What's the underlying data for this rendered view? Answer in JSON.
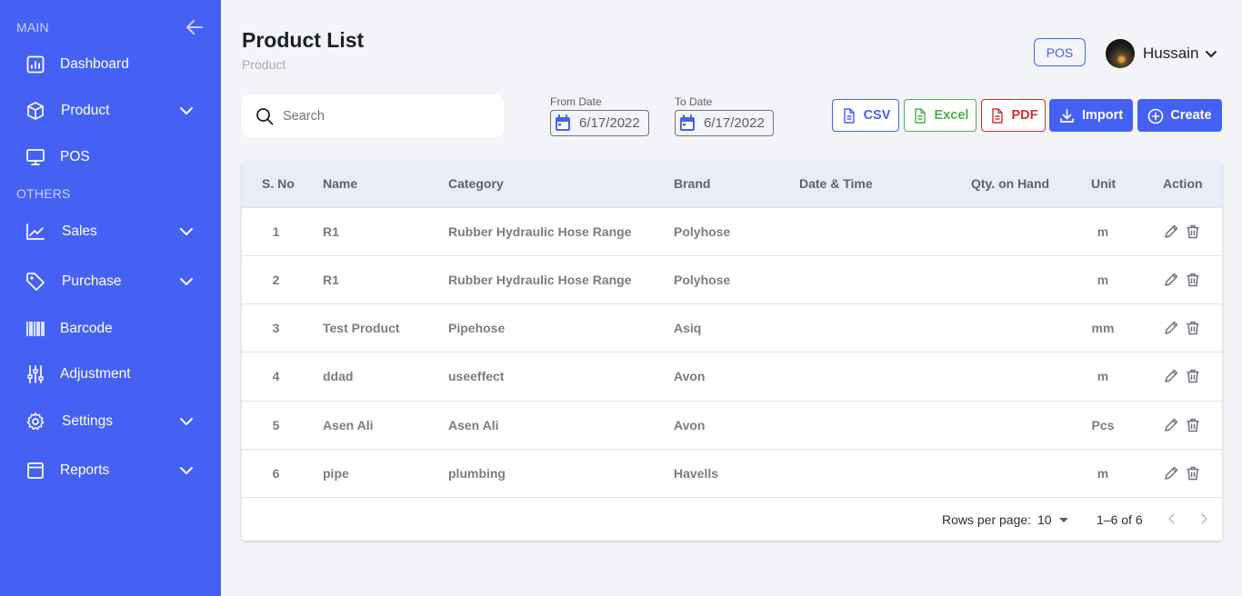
{
  "sidebar": {
    "section_main": "MAIN",
    "section_others": "OTHERS",
    "items": [
      {
        "label": "Dashboard",
        "icon": "dashboard-icon",
        "has_children": false
      },
      {
        "label": "Product",
        "icon": "box-icon",
        "has_children": true
      },
      {
        "label": "POS",
        "icon": "monitor-icon",
        "has_children": false
      },
      {
        "label": "Sales",
        "icon": "chart-line-icon",
        "has_children": true
      },
      {
        "label": "Purchase",
        "icon": "tag-icon",
        "has_children": true
      },
      {
        "label": "Barcode",
        "icon": "barcode-icon",
        "has_children": false
      },
      {
        "label": "Adjustment",
        "icon": "sliders-icon",
        "has_children": false
      },
      {
        "label": "Settings",
        "icon": "gear-icon",
        "has_children": true
      },
      {
        "label": "Reports",
        "icon": "window-icon",
        "has_children": true
      }
    ]
  },
  "header": {
    "title": "Product List",
    "breadcrumb": "Product",
    "pos_button": "POS",
    "user_name": "Hussain"
  },
  "toolbar": {
    "search_placeholder": "Search",
    "from_date_label": "From Date",
    "from_date_value": "6/17/2022",
    "to_date_label": "To Date",
    "to_date_value": "6/17/2022",
    "csv_label": "CSV",
    "excel_label": "Excel",
    "pdf_label": "PDF",
    "import_label": "Import",
    "create_label": "Create"
  },
  "table": {
    "columns": [
      "S. No",
      "Name",
      "Category",
      "Brand",
      "Date & Time",
      "Qty. on Hand",
      "Unit",
      "Action"
    ],
    "rows": [
      {
        "sno": "1",
        "name": "R1",
        "category": "Rubber Hydraulic Hose Range",
        "brand": "Polyhose",
        "datetime": "",
        "qty": "",
        "unit": "m"
      },
      {
        "sno": "2",
        "name": "R1",
        "category": "Rubber Hydraulic Hose Range",
        "brand": "Polyhose",
        "datetime": "",
        "qty": "",
        "unit": "m"
      },
      {
        "sno": "3",
        "name": "Test Product",
        "category": "Pipehose",
        "brand": "Asiq",
        "datetime": "",
        "qty": "",
        "unit": "mm"
      },
      {
        "sno": "4",
        "name": "ddad",
        "category": "useeffect",
        "brand": "Avon",
        "datetime": "",
        "qty": "",
        "unit": "m"
      },
      {
        "sno": "5",
        "name": "Asen Ali",
        "category": "Asen Ali",
        "brand": "Avon",
        "datetime": "",
        "qty": "",
        "unit": "Pcs"
      },
      {
        "sno": "6",
        "name": "pipe",
        "category": "plumbing",
        "brand": "Havells",
        "datetime": "",
        "qty": "",
        "unit": "m"
      }
    ],
    "footer": {
      "rows_per_page_label": "Rows per page:",
      "rows_per_page_value": "10",
      "range": "1–6 of 6"
    }
  },
  "colors": {
    "brand": "#4561f3",
    "excel": "#4caf50",
    "pdf": "#d32f2f",
    "background": "#f3f4f7"
  }
}
